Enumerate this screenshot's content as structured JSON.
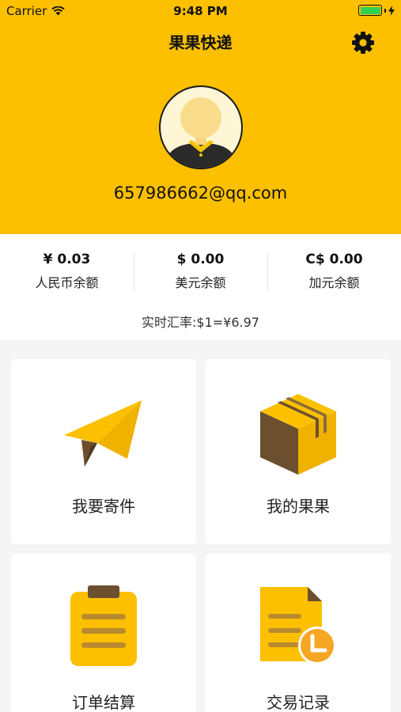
{
  "status_bar": {
    "carrier": "Carrier",
    "time": "9:48 PM"
  },
  "header": {
    "title": "果果快递",
    "email": "657986662@qq.com"
  },
  "balances": [
    {
      "amount": "¥ 0.03",
      "label": "人民币余额"
    },
    {
      "amount": "$ 0.00",
      "label": "美元余额"
    },
    {
      "amount": "C$ 0.00",
      "label": "加元余额"
    }
  ],
  "rate": "实时汇率:$1=¥6.97",
  "menu": [
    {
      "label": "我要寄件",
      "icon": "paper-plane-icon"
    },
    {
      "label": "我的果果",
      "icon": "package-box-icon"
    },
    {
      "label": "订单结算",
      "icon": "clipboard-icon"
    },
    {
      "label": "交易记录",
      "icon": "document-clock-icon"
    }
  ],
  "colors": {
    "brand_yellow": "#fcc000",
    "dark_brown": "#6b4f2e",
    "orange": "#f5a623"
  }
}
